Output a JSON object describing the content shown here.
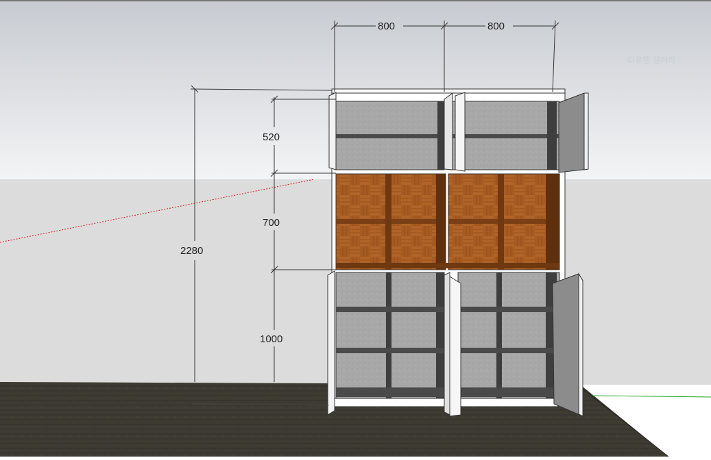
{
  "viewport": {
    "watermark": "디유렐 갤러리"
  },
  "dimensions": {
    "top_width_left": "800",
    "top_width_right": "800",
    "total_height": "2280",
    "upper_section": "520",
    "middle_section": "700",
    "lower_section": "1000"
  },
  "colors": {
    "sky_top": "#c8ccd2",
    "sky_bottom": "#f4f5f6",
    "wall": "#dcdcdc",
    "floor": "#3c3a31",
    "cabinet_white": "#ffffff",
    "cabinet_back": "#a9a9a9",
    "wood": "#a85c24",
    "door_gray": "#8c8c8c",
    "green_axis": "#1fa41f",
    "red_axis": "#c81e1e"
  }
}
